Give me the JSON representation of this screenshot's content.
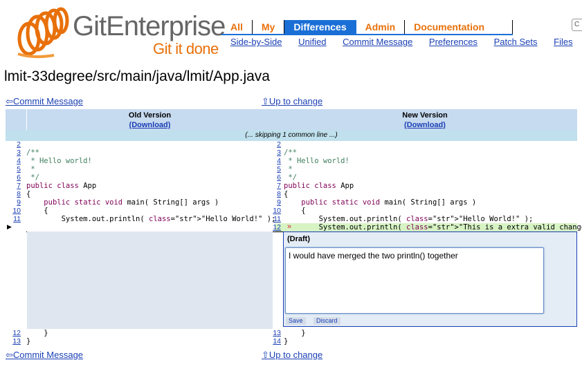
{
  "logo": {
    "brand": "GitEnterprise",
    "tagline": "Git it done"
  },
  "nav": {
    "tabs": [
      {
        "label": "All",
        "active": false
      },
      {
        "label": "My",
        "active": false
      },
      {
        "label": "Differences",
        "active": true
      },
      {
        "label": "Admin",
        "active": false
      },
      {
        "label": "Documentation",
        "active": false
      }
    ],
    "subnav": [
      "Side-by-Side",
      "Unified",
      "Commit Message",
      "Preferences",
      "Patch Sets",
      "Files"
    ],
    "search_fragment": "C"
  },
  "page": {
    "title": "lmit-33degree/src/main/java/lmit/App.java",
    "commit_message_link": "⇦Commit Message",
    "up_to_change_link": "⇧Up to change"
  },
  "diff": {
    "old_header": "Old Version",
    "new_header": "New Version",
    "download": "(Download)",
    "skip_text": "(... skipping 1 common line ...)",
    "old_lines": [
      {
        "n": "2",
        "code": ""
      },
      {
        "n": "3",
        "code": "/**"
      },
      {
        "n": "4",
        "code": " * Hello world!"
      },
      {
        "n": "5",
        "code": " *"
      },
      {
        "n": "6",
        "code": " */"
      },
      {
        "n": "7",
        "code": "public class App"
      },
      {
        "n": "8",
        "code": "{"
      },
      {
        "n": "9",
        "code": "    public static void main( String[] args )"
      },
      {
        "n": "10",
        "code": "    {"
      },
      {
        "n": "11",
        "code": "        System.out.println( \"Hello World!\" );"
      }
    ],
    "new_lines": [
      {
        "n": "2",
        "code": ""
      },
      {
        "n": "3",
        "code": "/**"
      },
      {
        "n": "4",
        "code": " * Hello world!"
      },
      {
        "n": "5",
        "code": " *"
      },
      {
        "n": "6",
        "code": " */"
      },
      {
        "n": "7",
        "code": "public class App"
      },
      {
        "n": "8",
        "code": "{"
      },
      {
        "n": "9",
        "code": "    public static void main( String[] args )"
      },
      {
        "n": "10",
        "code": "    {"
      },
      {
        "n": "11",
        "code": "        System.out.println( \"Hello World!\" );"
      },
      {
        "n": "12",
        "code": "        System.out.println( \"This is a extra valid change\" );"
      }
    ],
    "old_tail": [
      {
        "n": "12",
        "code": "    }"
      },
      {
        "n": "13",
        "code": "}"
      }
    ],
    "new_tail": [
      {
        "n": "13",
        "code": "    }"
      },
      {
        "n": "14",
        "code": "}"
      }
    ],
    "added_marker": "»",
    "colors": {
      "header_bg": "#c6daf0",
      "skip_bg": "#bfe0ec",
      "added_bg": "#d7f3c4"
    }
  },
  "comment": {
    "status": "(Draft)",
    "text": "I would have merged the two println() together",
    "save_label": "Save",
    "discard_label": "Discard"
  }
}
